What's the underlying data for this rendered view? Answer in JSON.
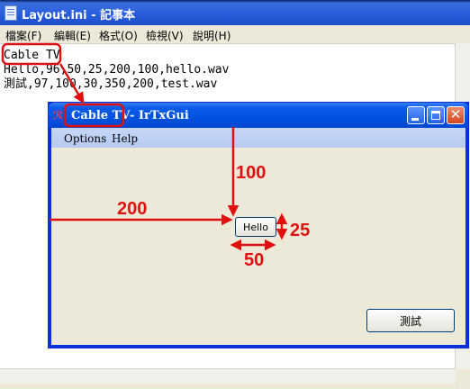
{
  "notepad": {
    "title": "Layout.ini - 記事本",
    "menu": [
      "檔案(F)",
      "編輯(E)",
      "格式(O)",
      "檢視(V)",
      "說明(H)"
    ],
    "lines": [
      "Cable TV",
      "Hello,96,50,25,200,100,hello.wav",
      "測試,97,100,30,350,200,test.wav"
    ]
  },
  "app": {
    "title_highlight": "Cable TV",
    "title_rest": "- IrTxGui",
    "menu": [
      "Options",
      "Help"
    ],
    "hello_button": "Hello",
    "test_button": "測試"
  },
  "annotations": {
    "top": "100",
    "left": "200",
    "height": "25",
    "width": "50"
  },
  "colors": {
    "annotation": "#e01010",
    "xp_blue": "#0052e0"
  }
}
